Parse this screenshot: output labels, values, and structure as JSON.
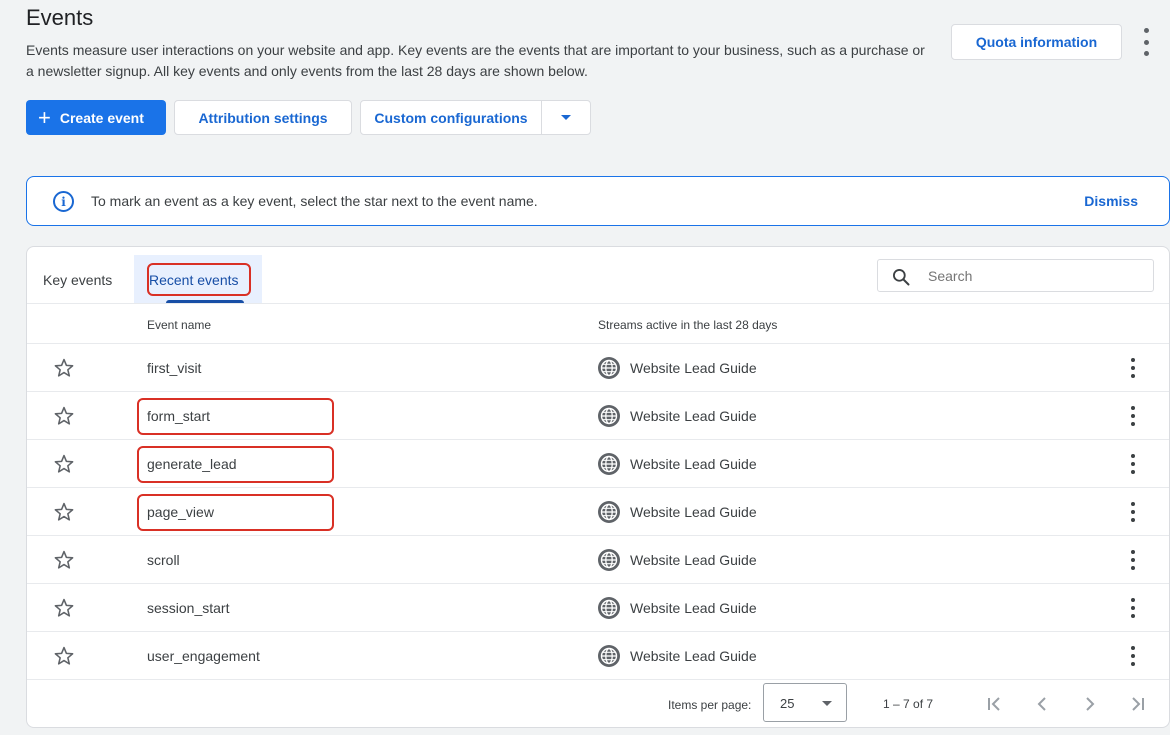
{
  "header": {
    "title": "Events",
    "description": "Events measure user interactions on your website and app. Key events are the events that are important to your business, such as a purchase or a newsletter signup. All key events and only events from the last 28 days are shown below.",
    "quota_button": "Quota information",
    "more_icon": "more-vert-icon"
  },
  "toolbar": {
    "create_label": "Create event",
    "create_icon": "plus-icon",
    "attribution_label": "Attribution settings",
    "custom_config_label": "Custom configurations",
    "custom_config_dropdown_icon": "caret-down-icon"
  },
  "banner": {
    "icon": "info-icon",
    "text": "To mark an event as a key event, select the star next to the event name.",
    "dismiss_label": "Dismiss"
  },
  "tabs": [
    {
      "label": "Key events",
      "active": false
    },
    {
      "label": "Recent events",
      "active": true
    }
  ],
  "search": {
    "placeholder": "Search",
    "value": ""
  },
  "table": {
    "columns": [
      "Event name",
      "Streams active in the last 28 days"
    ],
    "rows": [
      {
        "name": "first_visit",
        "stream": "Website Lead Guide",
        "highlighted": false
      },
      {
        "name": "form_start",
        "stream": "Website Lead Guide",
        "highlighted": true
      },
      {
        "name": "generate_lead",
        "stream": "Website Lead Guide",
        "highlighted": true
      },
      {
        "name": "page_view",
        "stream": "Website Lead Guide",
        "highlighted": true
      },
      {
        "name": "scroll",
        "stream": "Website Lead Guide",
        "highlighted": false
      },
      {
        "name": "session_start",
        "stream": "Website Lead Guide",
        "highlighted": false
      },
      {
        "name": "user_engagement",
        "stream": "Website Lead Guide",
        "highlighted": false
      }
    ]
  },
  "pagination": {
    "items_per_page_label": "Items per page:",
    "items_per_page_value": "25",
    "range": "1 – 7 of 7"
  },
  "colors": {
    "primary": "#1a73e8",
    "link": "#1967d2",
    "highlight": "#d93025",
    "active_tab_bg": "#e8f0fe"
  }
}
